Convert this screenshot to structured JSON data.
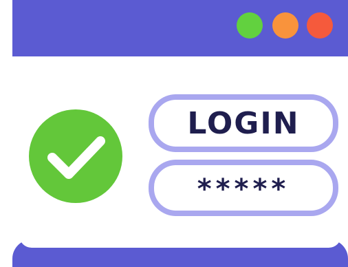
{
  "window": {
    "titlebar_color": "#5b5bd2",
    "controls": [
      {
        "name": "green-dot",
        "color": "#62d13f"
      },
      {
        "name": "orange-dot",
        "color": "#f9933c"
      },
      {
        "name": "red-dot",
        "color": "#f55a3c"
      }
    ]
  },
  "status": {
    "icon": "checkmark-icon",
    "color": "#63c73a"
  },
  "form": {
    "login_field": "LOGIN",
    "password_field": "*****",
    "field_border_color": "#a9a7ef"
  }
}
